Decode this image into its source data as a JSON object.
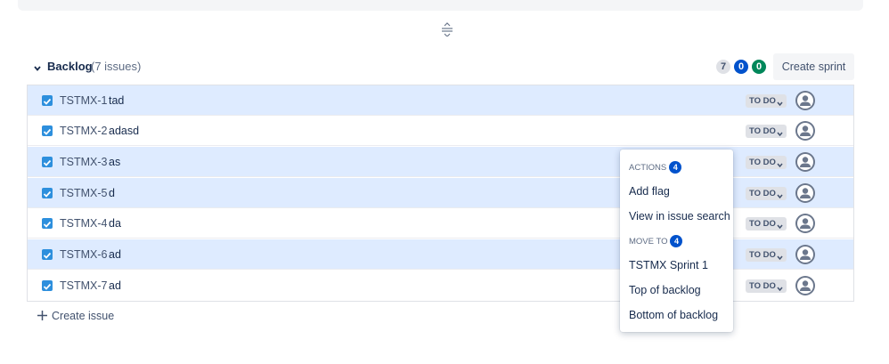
{
  "backlog": {
    "title": "Backlog",
    "issue_count_text": "(7 issues)",
    "counts": {
      "todo": "7",
      "in_progress": "0",
      "done": "0"
    },
    "create_sprint_label": "Create sprint",
    "create_issue_label": "Create issue"
  },
  "issues": [
    {
      "key": "TSTMX-1",
      "summary": "tad",
      "status": "TO DO",
      "selected": true
    },
    {
      "key": "TSTMX-2",
      "summary": "adasd",
      "status": "TO DO",
      "selected": false
    },
    {
      "key": "TSTMX-3",
      "summary": "as",
      "status": "TO DO",
      "selected": true
    },
    {
      "key": "TSTMX-5",
      "summary": "d",
      "status": "TO DO",
      "selected": true
    },
    {
      "key": "TSTMX-4",
      "summary": "da",
      "status": "TO DO",
      "selected": false
    },
    {
      "key": "TSTMX-6",
      "summary": "ad",
      "status": "TO DO",
      "selected": true
    },
    {
      "key": "TSTMX-7",
      "summary": "ad",
      "status": "TO DO",
      "selected": false
    }
  ],
  "context_menu": {
    "actions_heading": "ACTIONS",
    "actions_count": "4",
    "add_flag": "Add flag",
    "view_in_issue_search": "View in issue search",
    "move_to_heading": "MOVE TO",
    "move_to_count": "4",
    "sprint_1": "TSTMX Sprint 1",
    "top_of_backlog": "Top of backlog",
    "bottom_of_backlog": "Bottom of backlog"
  },
  "colors": {
    "selected_row": "#deebff",
    "checkbox": "#2d8fdd",
    "badge_blue": "#0052cc",
    "badge_green": "#00875a"
  }
}
